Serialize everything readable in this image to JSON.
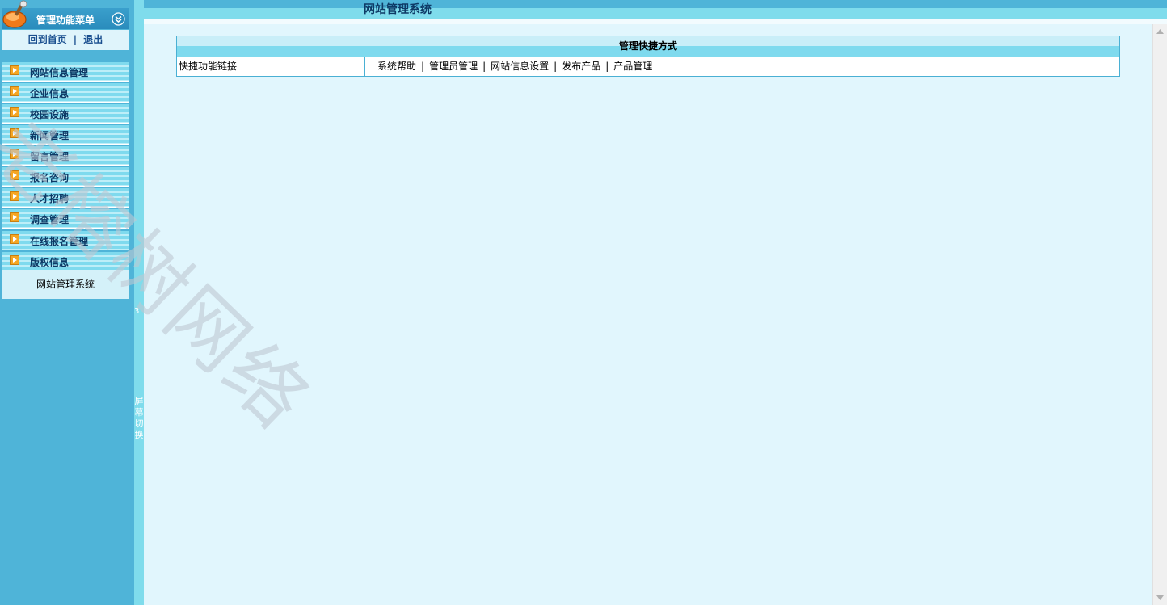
{
  "sidebar": {
    "header_title": "管理功能菜单",
    "nav": {
      "home": "回到首页",
      "separator": "|",
      "logout": "退出"
    },
    "items": [
      {
        "label": "网站信息管理"
      },
      {
        "label": "企业信息"
      },
      {
        "label": "校园设施"
      },
      {
        "label": "新闻管理"
      },
      {
        "label": "留言管理"
      },
      {
        "label": "报名咨询"
      },
      {
        "label": "人才招聘"
      },
      {
        "label": "调查管理"
      },
      {
        "label": "在线报名管理"
      },
      {
        "label": "版权信息"
      }
    ],
    "footer": "网站管理系统"
  },
  "splitter": {
    "number": "3",
    "toggle_label": "屏幕切换"
  },
  "topbar": {
    "title": "网站管理系统"
  },
  "shortcut_table": {
    "header": "管理快捷方式",
    "row_label": "快捷功能链接",
    "links": [
      "系统帮助",
      "管理员管理",
      "网站信息设置",
      "发布产品",
      "产品管理"
    ],
    "separator": "|"
  },
  "watermark": "老榕树网络",
  "colors": {
    "sidebar_bg": "#4fb4d8",
    "accent": "#7fdcec",
    "main_bg": "#e1f6fd",
    "menu_text": "#0e3a66"
  }
}
